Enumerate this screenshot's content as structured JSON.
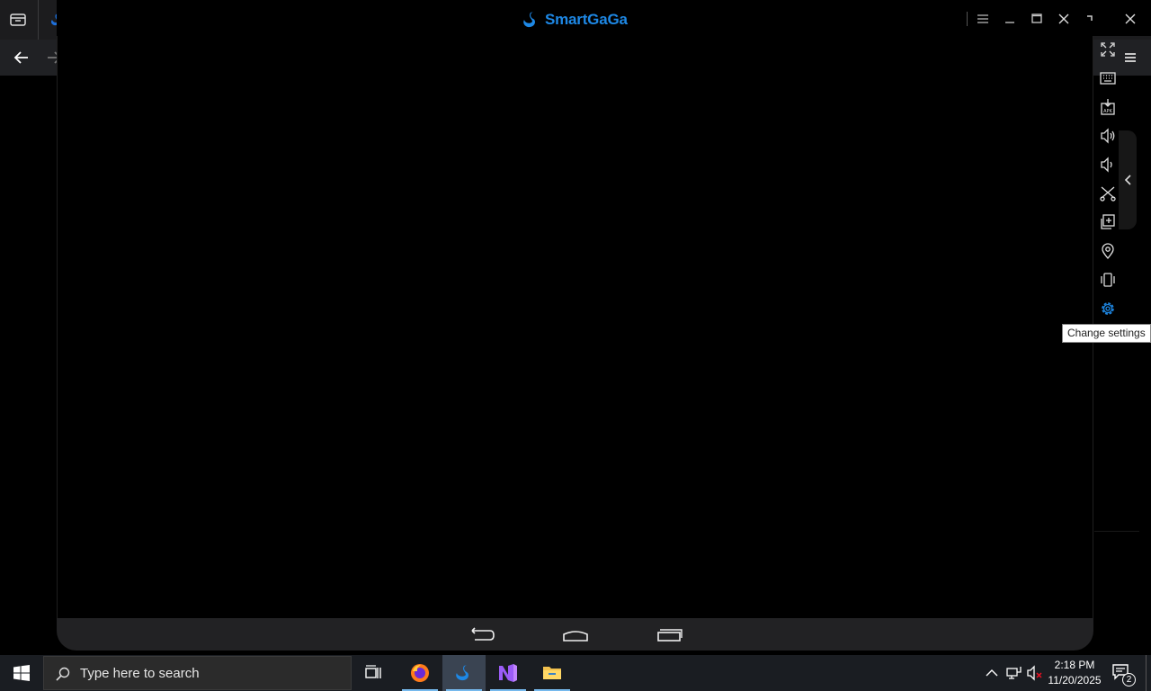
{
  "emulator": {
    "app_name": "SmartGaGa",
    "brand_color": "#1e88e5",
    "title_controls": [
      "menu-icon",
      "minimize-icon",
      "maximize-icon",
      "close-icon",
      "pin-icon"
    ],
    "toolbar": {
      "buttons": [
        "fullscreen-icon",
        "keyboard-icon",
        "apk-install-icon",
        "volume-up-icon",
        "volume-down-icon",
        "screenshot-scissors-icon",
        "multi-instance-icon",
        "location-icon",
        "shake-icon",
        "settings-icon"
      ],
      "active_button": "settings-icon",
      "tooltip": "Change settings"
    },
    "android_nav": [
      "back-icon",
      "home-icon",
      "recents-icon"
    ]
  },
  "browser": {
    "icons": [
      "tab-menu-icon",
      "swan-icon",
      "back-arrow-icon",
      "forward-arrow-icon",
      "hamburger-icon"
    ]
  },
  "taskbar": {
    "search_placeholder": "Type here to search",
    "apps": [
      "task-view-icon",
      "firefox-icon",
      "smartgaga-icon",
      "visual-studio-icon",
      "file-explorer-icon"
    ],
    "active_app": "smartgaga-icon",
    "clock": {
      "time": "2:18 PM",
      "date": "11/20/2025"
    },
    "notification_count": "2"
  }
}
